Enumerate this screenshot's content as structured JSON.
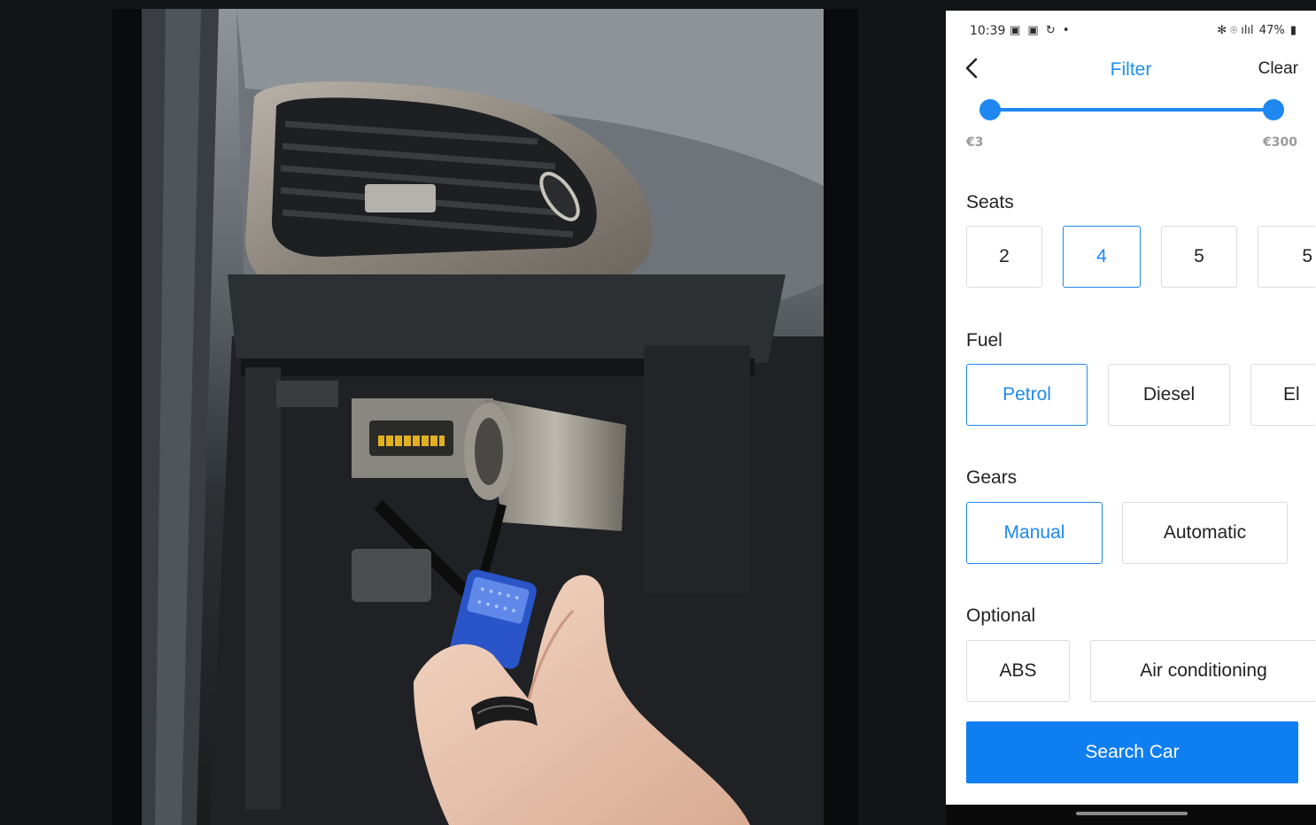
{
  "video": {
    "scene_description_icon": "car-dashboard-obd-adapter-image"
  },
  "phone": {
    "status_bar": {
      "time": "10:39",
      "left_icons": "▣ ▣ ↻ •",
      "right_icons": "✻ ⌾ ılıl",
      "battery": "47%"
    },
    "header": {
      "title": "Filter",
      "clear_label": "Clear",
      "back_icon": "chevron-left-icon"
    },
    "price": {
      "min_label": "€3",
      "max_label": "€300"
    },
    "seats": {
      "label": "Seats",
      "options": [
        "2",
        "4",
        "5",
        "5"
      ],
      "selected": "4"
    },
    "fuel": {
      "label": "Fuel",
      "options": [
        "Petrol",
        "Diesel",
        "El"
      ],
      "selected": "Petrol"
    },
    "gears": {
      "label": "Gears",
      "options": [
        "Manual",
        "Automatic"
      ],
      "selected": "Manual"
    },
    "optional": {
      "label": "Optional",
      "options": [
        "ABS",
        "Air conditioning"
      ]
    },
    "search_button": "Search Car",
    "colors": {
      "accent": "#1e88f0",
      "button": "#0f7ef0",
      "border": "#dcdcdc"
    }
  }
}
